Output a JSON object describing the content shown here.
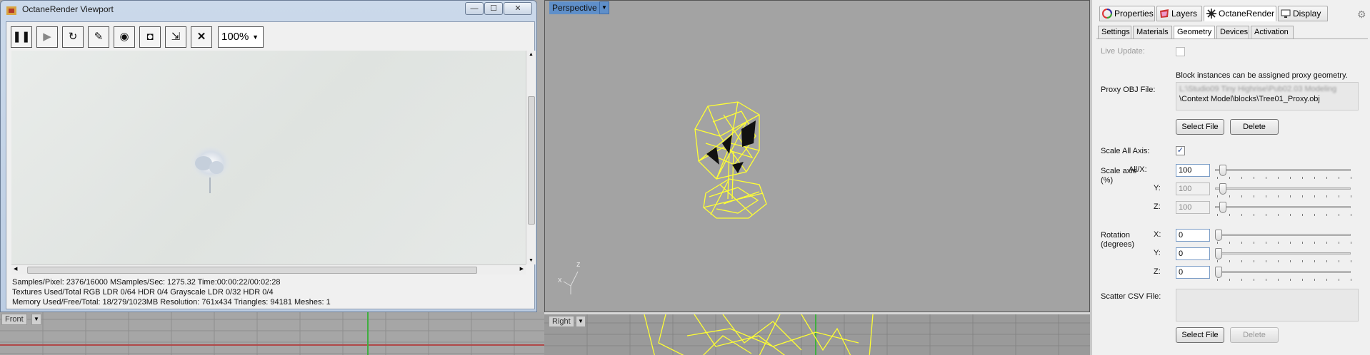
{
  "octane_window": {
    "title": "OctaneRender Viewport",
    "minimize_glyph": "—",
    "maximize_glyph": "☐",
    "close_glyph": "✕",
    "toolbar": {
      "pause_glyph": "❚❚",
      "play_glyph": "▶",
      "restart_glyph": "↻",
      "focus_glyph": "✎",
      "camera_glyph": "◉",
      "snapshot_glyph": "◘",
      "export_glyph": "⇲",
      "stop_glyph": "✕",
      "zoom_value": "100%"
    },
    "stats": {
      "line1": "Samples/Pixel: 2376/16000  MSamples/Sec: 1275.32  Time:00:00:22/00:02:28",
      "line2": "Textures Used/Total RGB LDR 0/64  HDR 0/4  Grayscale LDR 0/32  HDR 0/4",
      "line3": "Memory Used/Free/Total: 18/279/1023MB  Resolution: 761x434  Triangles: 94181  Meshes:  1"
    }
  },
  "viewports": {
    "front_label": "Front",
    "perspective_label": "Perspective",
    "right_label": "Right",
    "axis_x": "x",
    "axis_z": "z",
    "wire_color": "#ffff33"
  },
  "properties": {
    "tabs": [
      {
        "label": "Properties",
        "icon": "properties-icon"
      },
      {
        "label": "Layers",
        "icon": "layers-icon"
      },
      {
        "label": "OctaneRender",
        "icon": "octane-icon",
        "active": true
      },
      {
        "label": "Display",
        "icon": "display-icon"
      }
    ],
    "subtabs": [
      "Settings",
      "Materials",
      "Geometry",
      "Devices",
      "Activation"
    ],
    "active_subtab": "Geometry",
    "live_update_label": "Live Update:",
    "hint": "Block instances can be assigned proxy geometry.",
    "proxy_label": "Proxy OBJ File:",
    "proxy_path_line1": "L:\\Studio09 Tiny Highrise\\Pub02.03 Modeling",
    "proxy_path_line2": "\\Context Model\\blocks\\Tree01_Proxy.obj",
    "select_file": "Select File",
    "delete": "Delete",
    "scale_all_label": "Scale All Axis:",
    "scale_all_checked": "✓",
    "scale_label_1": "Scale axis",
    "scale_label_2": "(%)",
    "scale": [
      {
        "axis": "All/X:",
        "value": "100",
        "level": 0.03
      },
      {
        "axis": "Y:",
        "value": "100",
        "level": 0.03
      },
      {
        "axis": "Z:",
        "value": "100",
        "level": 0.03
      }
    ],
    "rotation_label_1": "Rotation",
    "rotation_label_2": "(degrees)",
    "rotation": [
      {
        "axis": "X:",
        "value": "0",
        "level": 0
      },
      {
        "axis": "Y:",
        "value": "0",
        "level": 0
      },
      {
        "axis": "Z:",
        "value": "0",
        "level": 0
      }
    ],
    "scatter_label": "Scatter CSV File:"
  }
}
